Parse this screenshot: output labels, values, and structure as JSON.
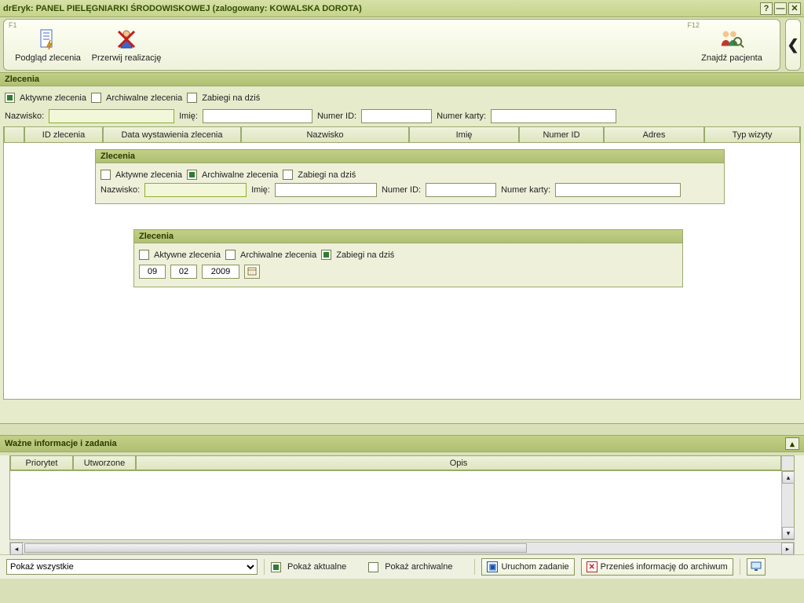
{
  "window": {
    "title": "drEryk: PANEL PIELĘGNIARKI ŚRODOWISKOWEJ (zalogowany: KOWALSKA DOROTA)",
    "help": "?",
    "minimize": "—",
    "close": "✕"
  },
  "toolbar": {
    "f1_key": "F1",
    "f12_key": "F12",
    "view_order": "Podgląd zlecenia",
    "abort": "Przerwij realizację",
    "find_patient": "Znajdź pacjenta"
  },
  "orders": {
    "title": "Zlecenia",
    "active_label": "Aktywne zlecenia",
    "archive_label": "Archiwalne zlecenia",
    "today_label": "Zabiegi na dziś",
    "surname_label": "Nazwisko:",
    "name_label": "Imię:",
    "id_label": "Numer ID:",
    "card_label": "Numer karty:",
    "columns": {
      "id": "ID zlecenia",
      "issue_date": "Data wystawienia zlecenia",
      "surname": "Nazwisko",
      "name": "Imię",
      "numid": "Numer ID",
      "address": "Adres",
      "visit_type": "Typ wizyty"
    }
  },
  "panel2": {
    "title": "Zlecenia",
    "active_label": "Aktywne zlecenia",
    "archive_label": "Archiwalne zlecenia",
    "today_label": "Zabiegi na dziś",
    "surname_label": "Nazwisko:",
    "name_label": "Imię:",
    "id_label": "Numer ID:",
    "card_label": "Numer karty:"
  },
  "panel3": {
    "title": "Zlecenia",
    "active_label": "Aktywne zlecenia",
    "archive_label": "Archiwalne zlecenia",
    "today_label": "Zabiegi na dziś",
    "date": {
      "day": "09",
      "month": "02",
      "year": "2009"
    }
  },
  "tasks": {
    "title": "Ważne informacje i zadania",
    "columns": {
      "priority": "Priorytet",
      "created": "Utworzone",
      "desc": "Opis"
    }
  },
  "bottom": {
    "combo_value": "Pokaż wszystkie",
    "show_current": "Pokaż aktualne",
    "show_archive": "Pokaż archiwalne",
    "run_task": "Uruchom zadanie",
    "archive_task": "Przenieś informację do archiwum"
  }
}
